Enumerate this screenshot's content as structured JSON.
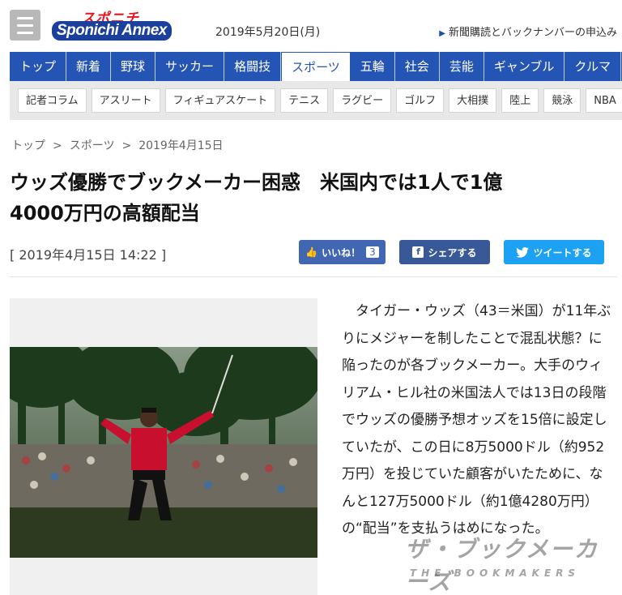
{
  "header": {
    "logo_top": "スポニチ",
    "logo_main": "Sponichi Annex",
    "date": "2019年5月20日(月)",
    "subscribe": "新聞購読とバックナンバーの申込み"
  },
  "mainnav": [
    "トップ",
    "新着",
    "野球",
    "サッカー",
    "格闘技",
    "スポーツ",
    "五輪",
    "社会",
    "芸能",
    "ギャンブル",
    "クルマ"
  ],
  "mainnav_active": "スポーツ",
  "subnav": [
    "記者コラム",
    "アスリート",
    "フィギュアスケート",
    "テニス",
    "ラグビー",
    "ゴルフ",
    "大相撲",
    "陸上",
    "競泳",
    "NBA"
  ],
  "breadcrumb": [
    "トップ",
    "スポーツ",
    "2019年4月15日"
  ],
  "breadcrumb_sep": ">",
  "article": {
    "title_line1": "ウッズ優勝でブックメーカー困惑　米国内では1人で1億",
    "title_line2": "4000万円の高額配当",
    "pubdate": "[ 2019年4月15日 14:22 ]",
    "like_label": "いいね！",
    "like_count": "3",
    "share_label": "シェアする",
    "tweet_label": "ツイートする",
    "body": "タイガー・ウッズ（43＝米国）が11年ぶりにメジャーを制したことで混乱状態？に陥ったのが各ブックメーカー。大手のウィリアム・ヒル社の米国法人では13日の段階でウッズの優勝予想オッズを15倍に設定していたが、この日に8万5000ドル（約952万円）を投じていた顧客がいたために、なんと127万5000ドル（約1億4280万円）の“配当”を支払うはめになった。"
  },
  "watermark": {
    "jp": "ザ・ブックメーカーズ",
    "en": "THE BOOKMAKERS"
  },
  "colors": {
    "nav_blue": "#2454b4",
    "facebook": "#4267b2",
    "twitter": "#1da1f2",
    "logo_red": "#e8141c"
  }
}
